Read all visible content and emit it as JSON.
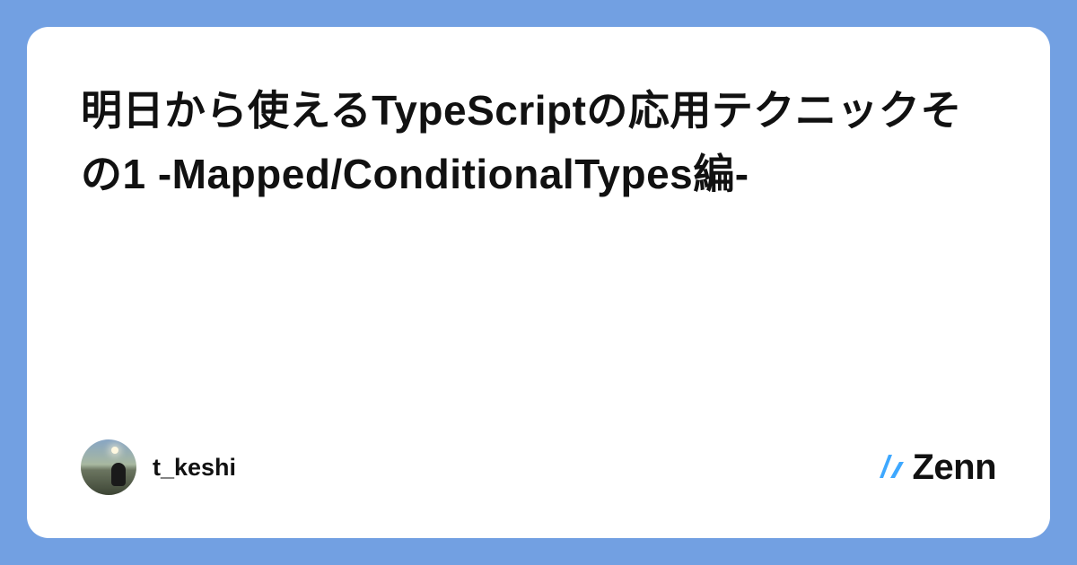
{
  "card": {
    "title": "明日から使えるTypeScriptの応用テクニックその1 -Mapped/ConditionalTypes編-"
  },
  "author": {
    "username": "t_keshi"
  },
  "brand": {
    "name": "Zenn",
    "accent": "#3ea8ff"
  }
}
